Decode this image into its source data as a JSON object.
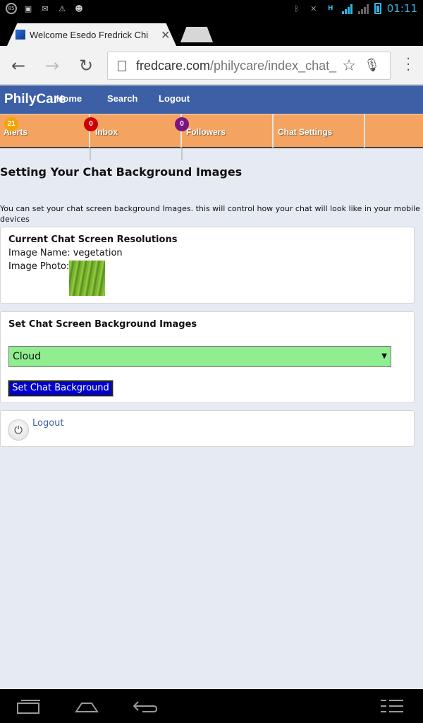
{
  "status_bar": {
    "left_icons": [
      "notification-count-icon",
      "image-icon",
      "message-icon",
      "warning-icon",
      "chat-icon"
    ],
    "notification_count": "85",
    "network_type": "H",
    "time": "01:11"
  },
  "browser": {
    "tab_title": "Welcome Esedo Fredrick Chi",
    "url_domain": "fredcare.com",
    "url_path": "/philycare/index_chat_"
  },
  "site": {
    "brand": "PhilyCare",
    "nav": [
      "Home",
      "Search",
      "Logout"
    ]
  },
  "tabbar": {
    "items": [
      {
        "label": "Alerts",
        "badge": "21",
        "badge_color": "#f5a300"
      },
      {
        "label": "Inbox",
        "badge": "0",
        "badge_color": "#cc0000"
      },
      {
        "label": "Followers",
        "badge": "0",
        "badge_color": "#7a1680"
      },
      {
        "label": "Chat Settings",
        "badge": ""
      }
    ]
  },
  "page": {
    "heading": "Setting Your Chat Background Images",
    "intro": "You can set your chat screen background Images. this will control how your chat will look like in your mobile devices"
  },
  "current": {
    "title": "Current Chat Screen Resolutions",
    "image_name_label": "Image Name:",
    "image_name": "vegetation",
    "image_photo_label": "Image Photo:"
  },
  "set_bg": {
    "title": "Set Chat Screen Background Images",
    "selected": "Cloud",
    "button": "Set Chat Background"
  },
  "logout_card": {
    "link": "Logout"
  },
  "colors": {
    "header_blue": "#3d5fa6",
    "tabbar_orange": "#f4a460",
    "select_green": "#90ee90",
    "button_blue": "#0000cc"
  }
}
